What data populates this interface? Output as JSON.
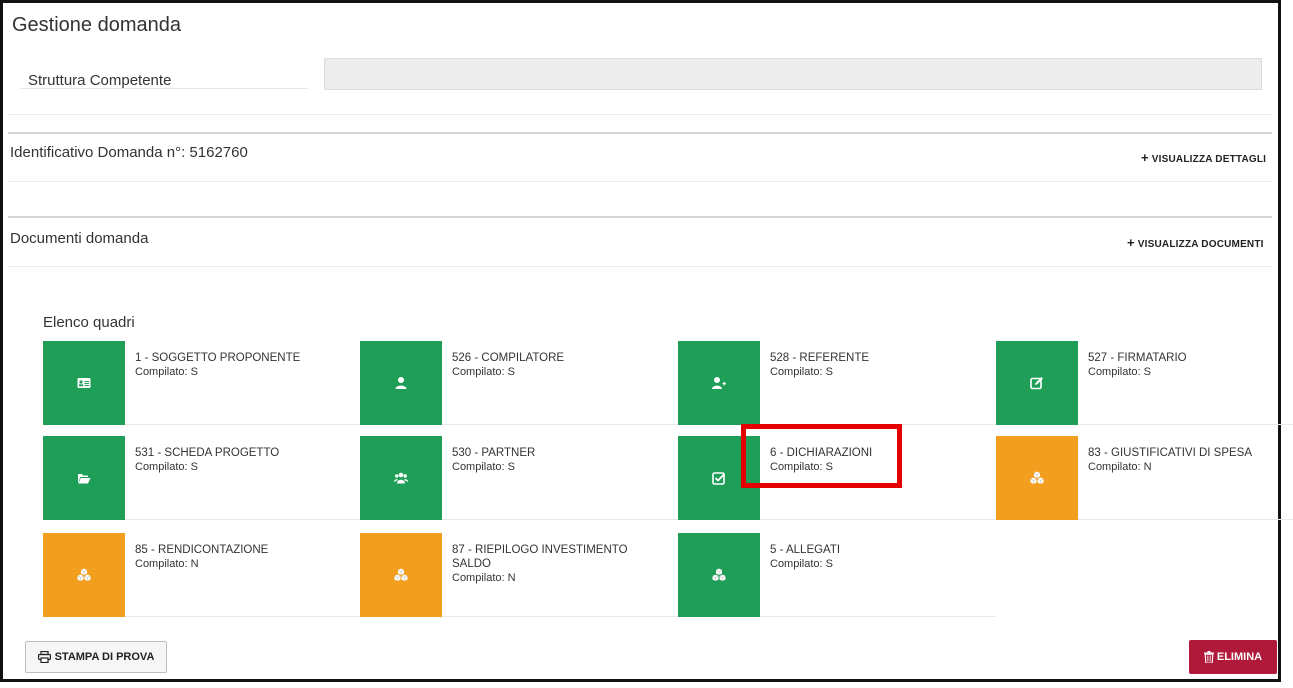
{
  "header": {
    "title": "Gestione domanda"
  },
  "struttura": {
    "label": "Struttura Competente",
    "value": ""
  },
  "identificativo": {
    "label": "Identificativo Domanda n°: 5162760",
    "link": "VISUALIZZA DETTAGLI"
  },
  "documenti": {
    "label": "Documenti domanda",
    "link": "VISUALIZZA DOCUMENTI"
  },
  "elenco": {
    "title": "Elenco quadri",
    "tiles": [
      {
        "name": "1 - SOGGETTO PROPONENTE",
        "status": "Compilato: S",
        "color": "#1e9e56",
        "icon": "id-card-icon"
      },
      {
        "name": "526 - COMPILATORE",
        "status": "Compilato: S",
        "color": "#1e9e56",
        "icon": "user-icon"
      },
      {
        "name": "528 - REFERENTE",
        "status": "Compilato: S",
        "color": "#1e9e56",
        "icon": "user-plus-icon"
      },
      {
        "name": "527 - FIRMATARIO",
        "status": "Compilato: S",
        "color": "#1e9e56",
        "icon": "edit-icon"
      },
      {
        "name": "531 - SCHEDA PROGETTO",
        "status": "Compilato: S",
        "color": "#1e9e56",
        "icon": "folder-open-icon"
      },
      {
        "name": "530 - PARTNER",
        "status": "Compilato: S",
        "color": "#1e9e56",
        "icon": "users-icon"
      },
      {
        "name": "6 - DICHIARAZIONI",
        "status": "Compilato: S",
        "color": "#1e9e56",
        "icon": "check-square-icon"
      },
      {
        "name": "83 - GIUSTIFICATIVI DI SPESA",
        "status": "Compilato: N",
        "color": "#f29f1f",
        "icon": "cubes-icon"
      },
      {
        "name": "85 - RENDICONTAZIONE",
        "status": "Compilato: N",
        "color": "#f29f1f",
        "icon": "cubes-icon"
      },
      {
        "name": "87 - RIEPILOGO INVESTIMENTO SALDO",
        "status": "Compilato: N",
        "color": "#f29f1f",
        "icon": "cubes-icon"
      },
      {
        "name": "5 - ALLEGATI",
        "status": "Compilato: S",
        "color": "#1e9e56",
        "icon": "cubes-icon"
      }
    ]
  },
  "buttons": {
    "print": "STAMPA DI PROVA",
    "delete": "ELIMINA"
  }
}
